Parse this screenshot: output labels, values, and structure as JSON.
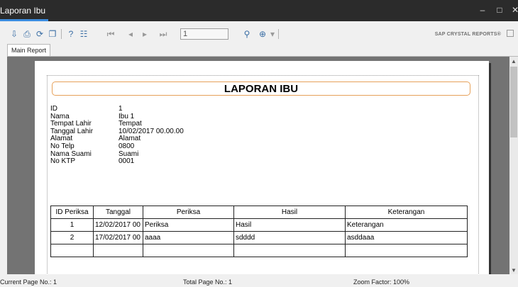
{
  "window": {
    "title": "Laporan Ibu",
    "minimize": "–",
    "maximize": "□",
    "close": "✕"
  },
  "toolbar": {
    "page_number": "1",
    "brand": "SAP CRYSTAL REPORTS®"
  },
  "tabs": [
    {
      "label": "Main Report"
    }
  ],
  "report": {
    "title": "LAPORAN IBU",
    "fields": [
      {
        "label": "ID",
        "value": "1"
      },
      {
        "label": "Nama",
        "value": "Ibu 1"
      },
      {
        "label": "Tempat Lahir",
        "value": "Tempat"
      },
      {
        "label": "Tanggal Lahir",
        "value": "10/02/2017  00.00.00"
      },
      {
        "label": "Alamat",
        "value": "Alamat"
      },
      {
        "label": "No Telp",
        "value": "0800"
      },
      {
        "label": "Nama Suami",
        "value": "Suami"
      },
      {
        "label": "No KTP",
        "value": "0001"
      }
    ],
    "table": {
      "headers": [
        "ID Periksa",
        "Tanggal",
        "Periksa",
        "Hasil",
        "Keterangan"
      ],
      "rows": [
        [
          "1",
          "12/02/2017  00",
          "Periksa",
          "Hasil",
          "Keterangan"
        ],
        [
          "2",
          "17/02/2017  00",
          "aaaa",
          "sdddd",
          "asddaaa"
        ]
      ]
    }
  },
  "status": {
    "current_page": "Current Page No.: 1",
    "total_page": "Total Page No.: 1",
    "zoom": "Zoom Factor: 100%"
  }
}
